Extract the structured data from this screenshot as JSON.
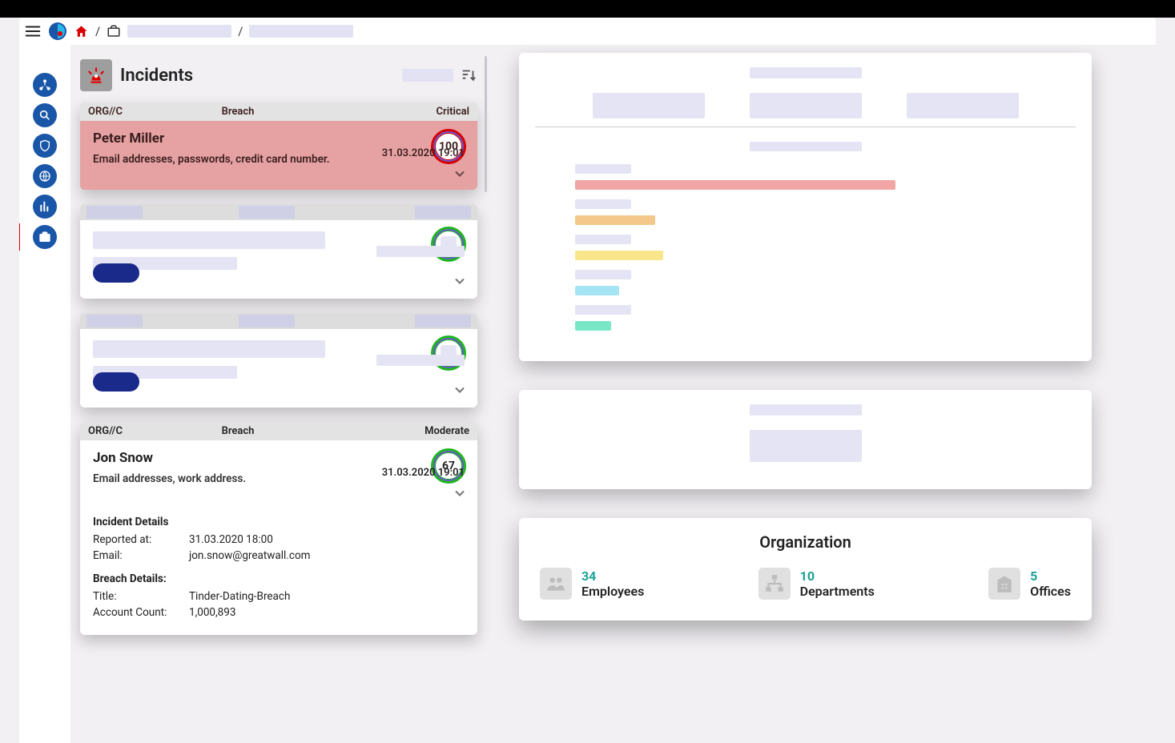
{
  "page": {
    "title": "Incidents"
  },
  "incident1": {
    "tag": "ORG//C",
    "type": "Breach",
    "severity": "Critical",
    "name": "Peter Miller",
    "desc": "Email addresses, passwords, credit card number.",
    "time": "31.03.2020 19:01",
    "score": "100"
  },
  "incident2": {
    "tag": "ORG//C",
    "type": "Breach",
    "severity": "Moderate",
    "name": "Jon Snow",
    "desc": "Email addresses, work address.",
    "time": "31.03.2020 19:01",
    "score": "67",
    "detailsTitle": "Incident Details",
    "reportedLabel": "Reported at:",
    "reported": "31.03.2020 18:00",
    "emailLabel": "Email:",
    "email": "jon.snow@greatwall.com",
    "breachTitle": "Breach Details:",
    "bTitleLabel": "Title:",
    "bTitle": "Tinder-Dating-Breach",
    "countLabel": "Account Count:",
    "count": "1,000,893"
  },
  "org": {
    "title": "Organization",
    "employeesNum": "34",
    "employees": "Employees",
    "deptsNum": "10",
    "depts": "Departments",
    "officesNum": "5",
    "offices": "Offices"
  }
}
